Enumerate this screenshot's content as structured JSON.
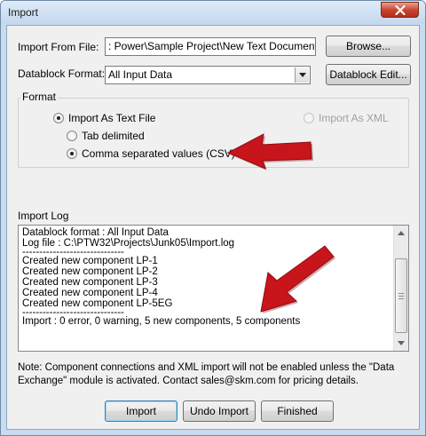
{
  "window": {
    "title": "Import"
  },
  "import_from_file": {
    "label": "Import From File:",
    "value": ": Power\\Sample Project\\New Text Document.txt",
    "browse_label": "Browse..."
  },
  "datablock_format": {
    "label": "Datablock Format:",
    "value": "All Input Data",
    "edit_label": "Datablock Edit..."
  },
  "format": {
    "title": "Format",
    "import_as_text": "Import As Text File",
    "tab_delimited": "Tab delimited",
    "csv": "Comma separated values (CSV)",
    "import_as_xml": "Import As XML",
    "selected_mode": "Import As Text File",
    "selected_delimiter": "Comma separated values (CSV)"
  },
  "import_log": {
    "title": "Import Log",
    "lines": [
      "Datablock format : All Input Data",
      "Log file :  C:\\PTW32\\Projects\\Junk05\\Import.log",
      "------------------------------",
      "Created new component LP-1",
      "Created new component LP-2",
      "Created new component LP-3",
      "Created new component LP-4",
      "Created new component LP-5EG",
      "------------------------------",
      "Import : 0 error, 0 warning, 5 new components, 5 components"
    ]
  },
  "note": "Note:  Component connections and XML import will not be enabled unless the \"Data Exchange\" module is activated.  Contact sales@skm.com for pricing details.",
  "buttons": {
    "import": "Import",
    "undo_import": "Undo Import",
    "finished": "Finished"
  },
  "colors": {
    "annotation_arrow": "#c8151b",
    "close_button": "#c7402b",
    "title_bar": "#c9dcef"
  },
  "icons": {
    "close": "close-x-icon",
    "dropdown": "chevron-down-icon",
    "annotation": "red-arrow-icon"
  }
}
